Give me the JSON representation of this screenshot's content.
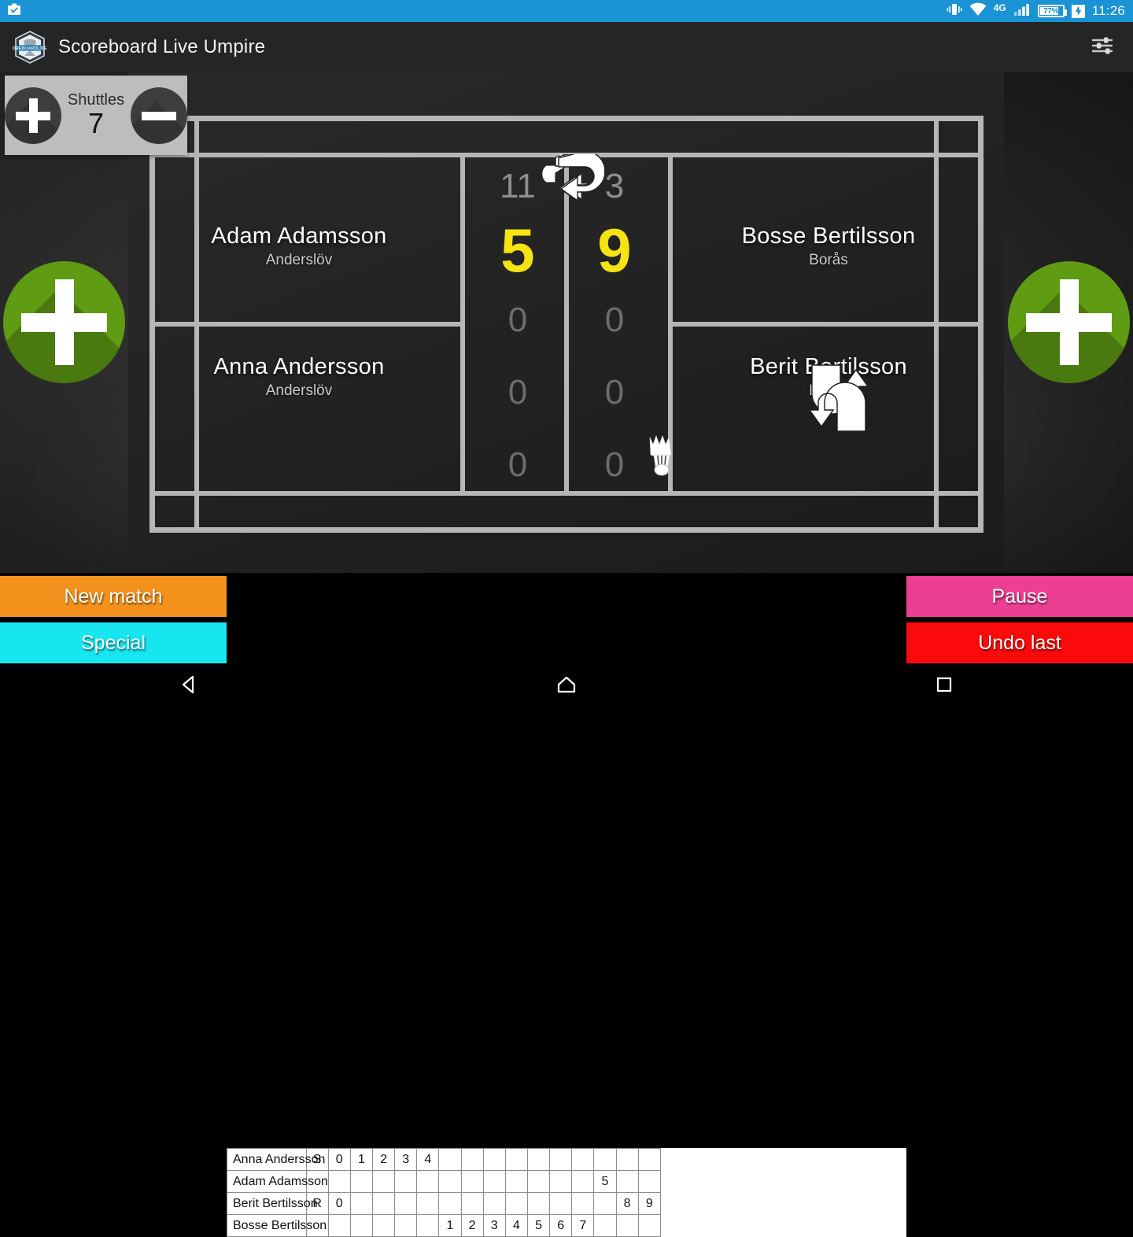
{
  "status_bar": {
    "time": "11:26",
    "battery_percent": "77%",
    "network_label": "4G",
    "icons": [
      "vibrate-icon",
      "wifi-icon",
      "signal-icon",
      "battery-icon",
      "charging-icon",
      "app-notification-icon"
    ]
  },
  "app_bar": {
    "title": "Scoreboard Live Umpire",
    "logo_name": "scoreboard-live-logo",
    "settings_icon": "sliders-icon"
  },
  "shuttles": {
    "label": "Shuttles",
    "count": "7",
    "increase_label": "+",
    "decrease_label": "-"
  },
  "court": {
    "left_team": {
      "top_player": {
        "name": "Adam Adamsson",
        "club": "Anderslöv"
      },
      "bottom_player": {
        "name": "Anna Andersson",
        "club": "Anderslöv"
      }
    },
    "right_team": {
      "top_player": {
        "name": "Bosse Bertilsson",
        "club": "Borås"
      },
      "bottom_player": {
        "name": "Berit Bertilsson",
        "club": "Borås"
      }
    },
    "swap_sides_icon": "swap-horizontal-icon",
    "swap_players_icon": "swap-vertical-icon",
    "serve_indicator_icon": "shuttlecock-icon",
    "serve_side": "right"
  },
  "scores": {
    "left": {
      "previous_set": "11",
      "current": "5",
      "set3": "0",
      "set4": "0",
      "set5": "0"
    },
    "right": {
      "previous_set": "3",
      "current": "9",
      "set3": "0",
      "set4": "0",
      "set5": "0"
    },
    "current_color": "#f5e312"
  },
  "add_point_buttons": {
    "left_label": "+",
    "right_label": "+",
    "color": "#5f9c14"
  },
  "actions": {
    "new_match": {
      "label": "New match",
      "color": "#f2921d"
    },
    "special": {
      "label": "Special",
      "color": "#17e6f0"
    },
    "pause": {
      "label": "Pause",
      "color": "#ec3f93"
    },
    "undo_last": {
      "label": "Undo last",
      "color": "#fa0a0a"
    }
  },
  "scoresheet": {
    "columns": 16,
    "rows": [
      {
        "player": "Anna Andersson",
        "cells": [
          "S",
          "0",
          "1",
          "2",
          "3",
          "4",
          "",
          "",
          "",
          "",
          "",
          "",
          "",
          "",
          "",
          ""
        ]
      },
      {
        "player": "Adam Adamsson",
        "cells": [
          "",
          "",
          "",
          "",
          "",
          "",
          "",
          "",
          "",
          "",
          "",
          "",
          "",
          "5",
          "",
          ""
        ]
      },
      {
        "player": "Berit Bertilsson",
        "cells": [
          "R",
          "0",
          "",
          "",
          "",
          "",
          "",
          "",
          "",
          "",
          "",
          "",
          "",
          "",
          "8",
          "9"
        ]
      },
      {
        "player": "Bosse Bertilsson",
        "cells": [
          "",
          "",
          "",
          "",
          "",
          "",
          "1",
          "2",
          "3",
          "4",
          "5",
          "6",
          "7",
          "",
          "",
          ""
        ]
      }
    ]
  },
  "nav_bar": {
    "back_icon": "back-triangle-icon",
    "home_icon": "home-pentagon-icon",
    "recents_icon": "recents-square-icon"
  }
}
